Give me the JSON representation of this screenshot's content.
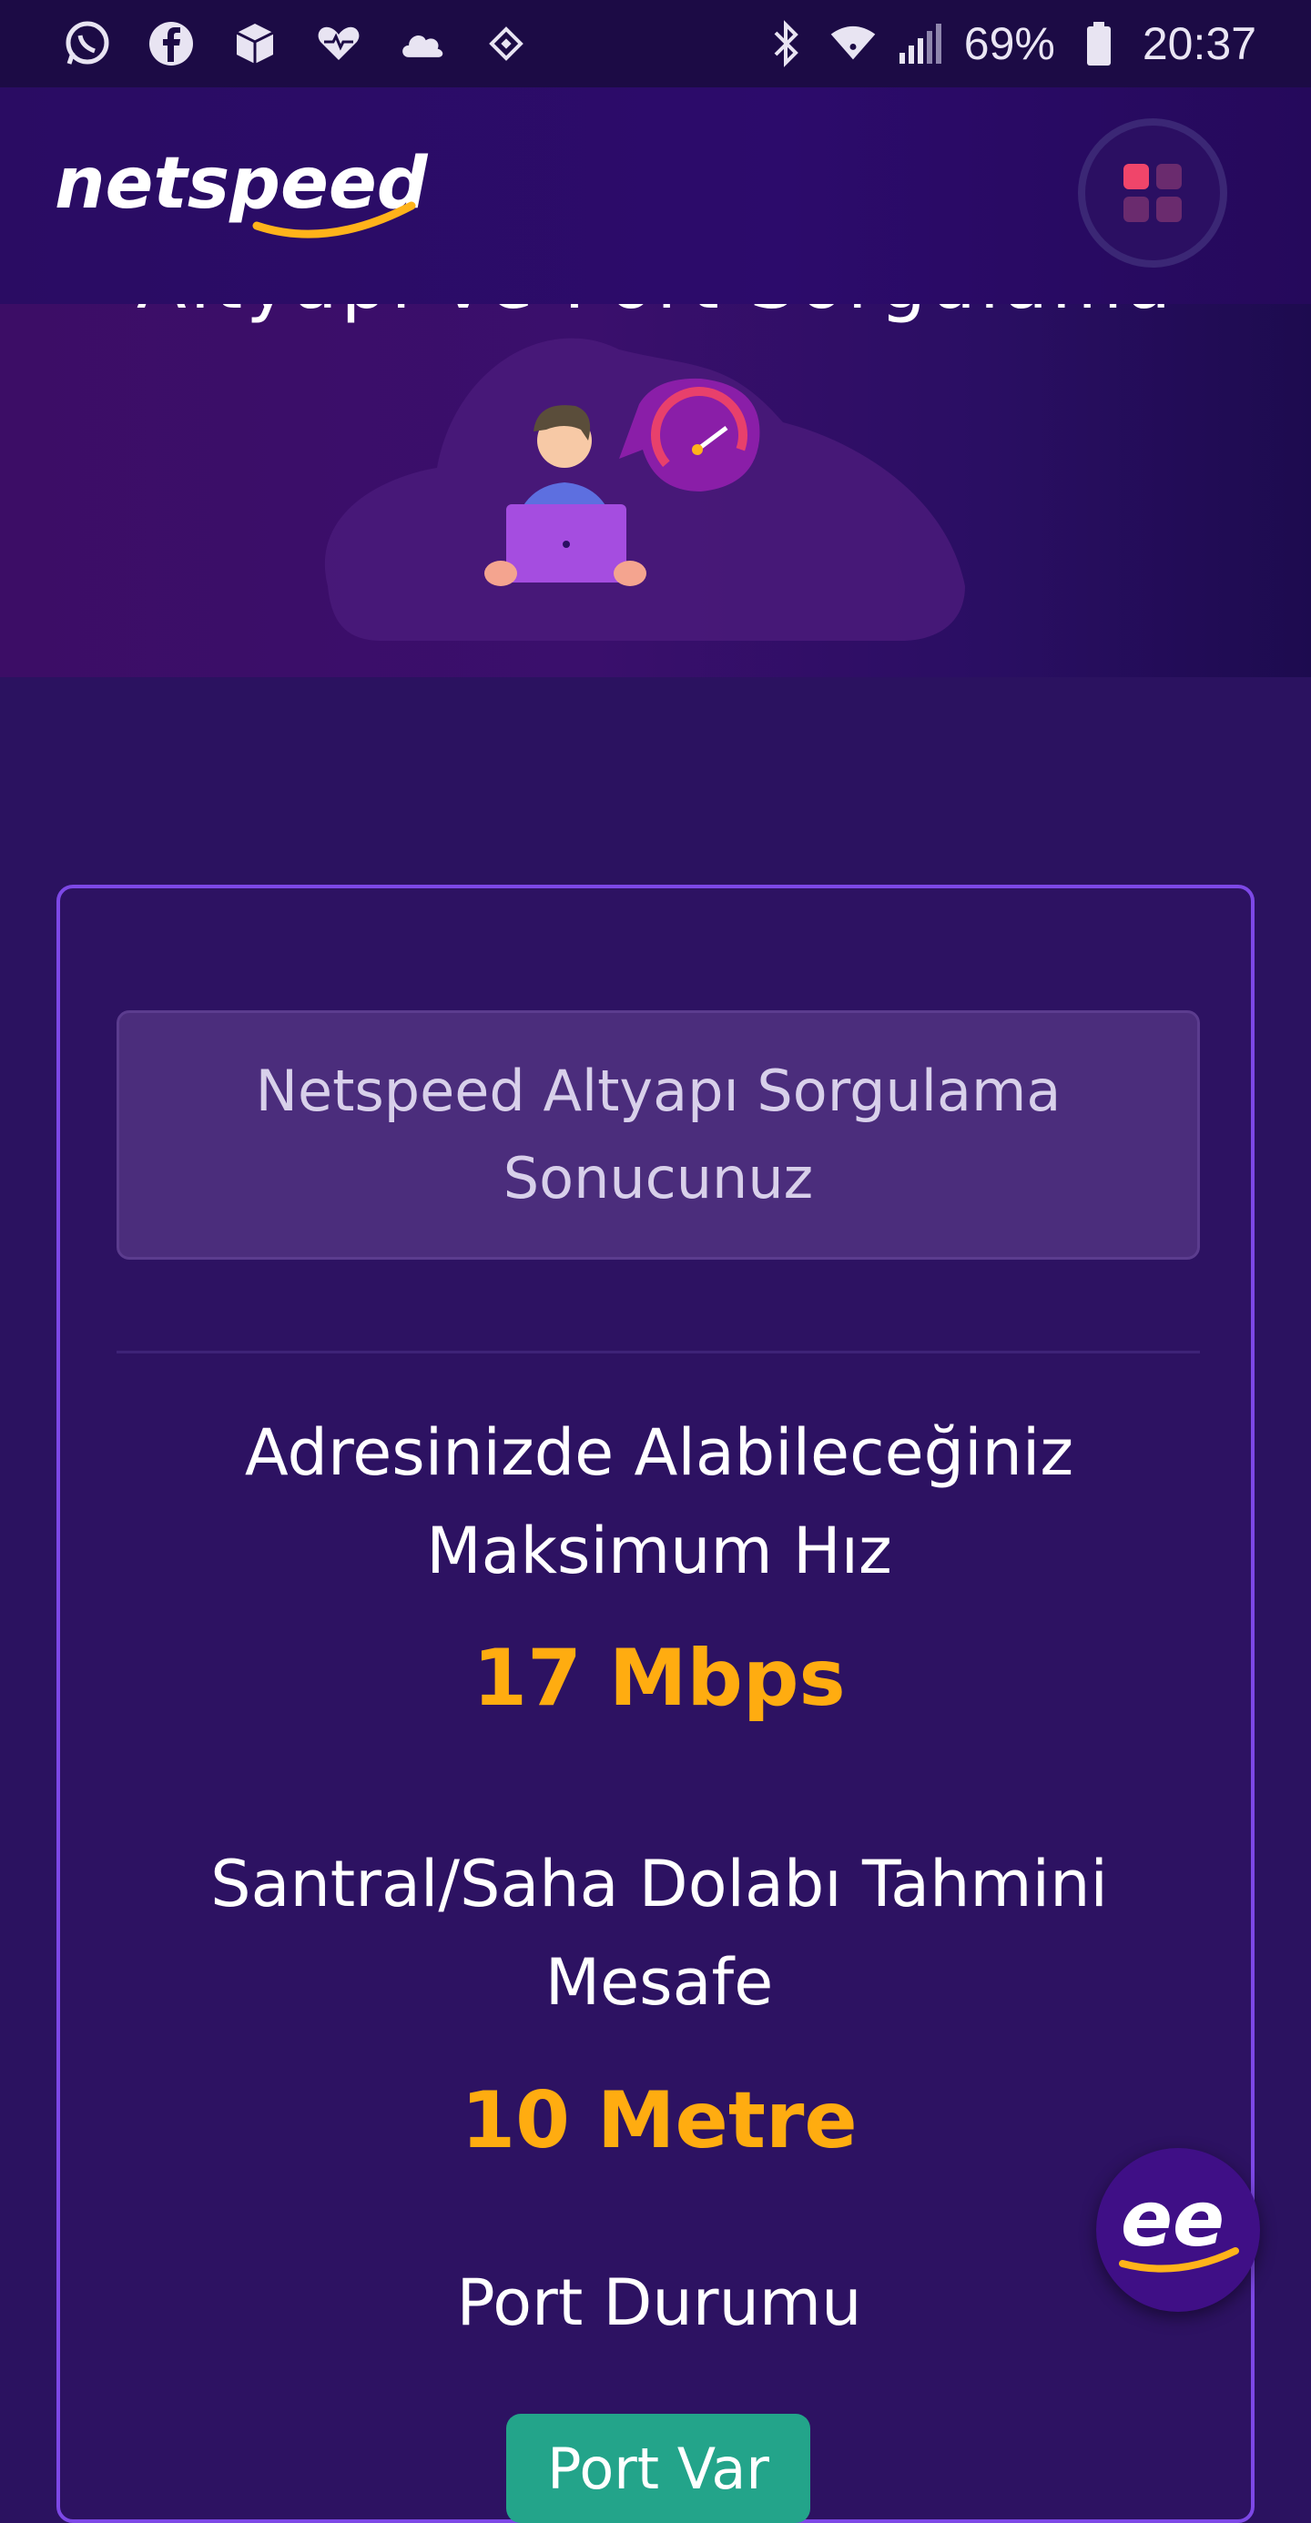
{
  "status_bar": {
    "left_icons": [
      "whatsapp-icon",
      "facebook-icon",
      "package-icon",
      "heart-monitor-icon",
      "cloud-icon",
      "binance-icon"
    ],
    "right_icons": [
      "bluetooth-icon",
      "wifi-icon",
      "signal-icon",
      "battery-icon"
    ],
    "battery_percent": "69%",
    "time": "20:37"
  },
  "header": {
    "logo_text": "netspeed",
    "menu_icon": "grid-menu-icon"
  },
  "hero": {
    "title": "Altyapı ve Port Sorgulama"
  },
  "result": {
    "heading": "Netspeed Altyapı Sorgulama Sonucunuz",
    "max_speed_label": "Adresinizde Alabileceğiniz Maksimum Hız",
    "max_speed_value": "17 Mbps",
    "distance_label": "Santral/Saha Dolabı Tahmini Mesafe",
    "distance_value": "10 Metre",
    "port_label": "Port Durumu",
    "port_button": "Port Var"
  },
  "chat": {
    "logo_text": "ee"
  },
  "colors": {
    "background": "#2b1260",
    "accent_orange": "#ffac10",
    "card_border": "#7d48e6",
    "port_green": "#23a48a"
  }
}
